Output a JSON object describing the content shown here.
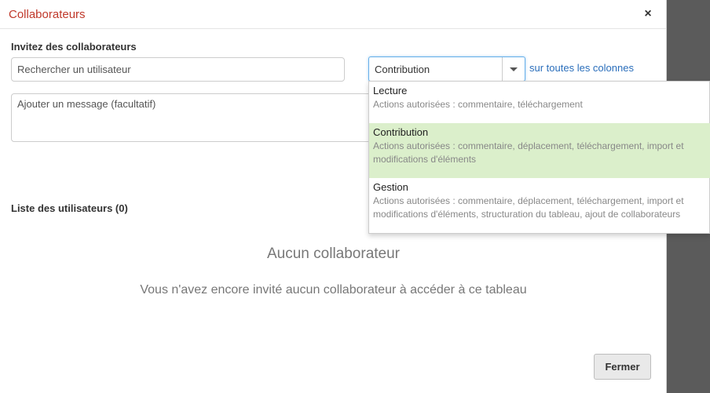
{
  "dialog": {
    "title": "Collaborateurs",
    "close_glyph": "×"
  },
  "invite": {
    "section_title": "Invitez des collaborateurs",
    "search_placeholder": "Rechercher un utilisateur",
    "message_placeholder": "Ajouter un message (facultatif)",
    "role_selected": "Contribution",
    "scope_link": "sur toutes les colonnes"
  },
  "role_options": [
    {
      "label": "Lecture",
      "description": "Actions autorisées : commentaire, téléchargement",
      "selected": false
    },
    {
      "label": "Contribution",
      "description": "Actions autorisées : commentaire, déplacement, téléchargement, import et modifications d'éléments",
      "selected": true
    },
    {
      "label": "Gestion",
      "description": "Actions autorisées : commentaire, déplacement, téléchargement, import et modifications d'éléments, structuration du tableau, ajout de collaborateurs",
      "selected": false
    }
  ],
  "users": {
    "section_title": "Liste des utilisateurs (0)",
    "empty_title": "Aucun collaborateur",
    "empty_text": "Vous n'avez encore invité aucun collaborateur à accéder à ce tableau"
  },
  "footer": {
    "close_label": "Fermer"
  },
  "colors": {
    "title": "#c0392b",
    "link": "#2a6ebb",
    "selected_option_bg": "#dbefcb",
    "overlay": "#5b5b5b"
  }
}
